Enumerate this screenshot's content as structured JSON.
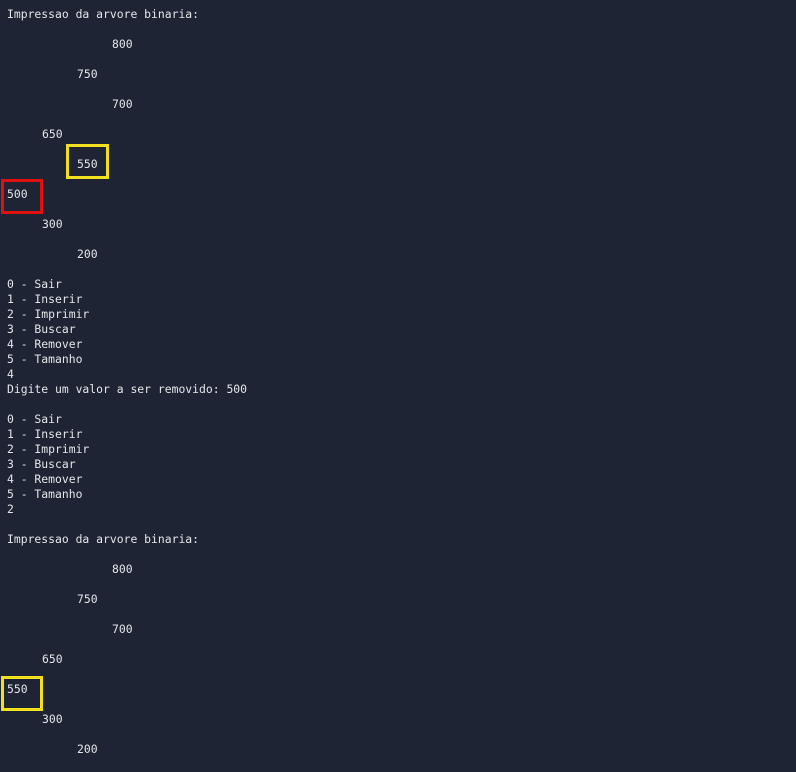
{
  "highlight_colors": {
    "red": "#e01010",
    "yellow": "#f0e020"
  },
  "text_color": "#e4e6ea",
  "background_color": "#1e2433",
  "first_print": {
    "header": "Impressao da arvore binaria:",
    "n800": "800",
    "n750": "750",
    "n700": "700",
    "n650": "650",
    "n550": "550",
    "n500": "500",
    "n300": "300",
    "n200": "200"
  },
  "menu1": {
    "opt0": "0 - Sair",
    "opt1": "1 - Inserir",
    "opt2": "2 - Imprimir",
    "opt3": "3 - Buscar",
    "opt4": "4 - Remover",
    "opt5": "5 - Tamanho",
    "choice": "4",
    "prompt": "Digite um valor a ser removido: 500"
  },
  "menu2": {
    "opt0": "0 - Sair",
    "opt1": "1 - Inserir",
    "opt2": "2 - Imprimir",
    "opt3": "3 - Buscar",
    "opt4": "4 - Remover",
    "opt5": "5 - Tamanho",
    "choice": "2"
  },
  "second_print": {
    "header": "Impressao da arvore binaria:",
    "n800": "800",
    "n750": "750",
    "n700": "700",
    "n650": "650",
    "n550": "550",
    "n300": "300",
    "n200": "200"
  }
}
